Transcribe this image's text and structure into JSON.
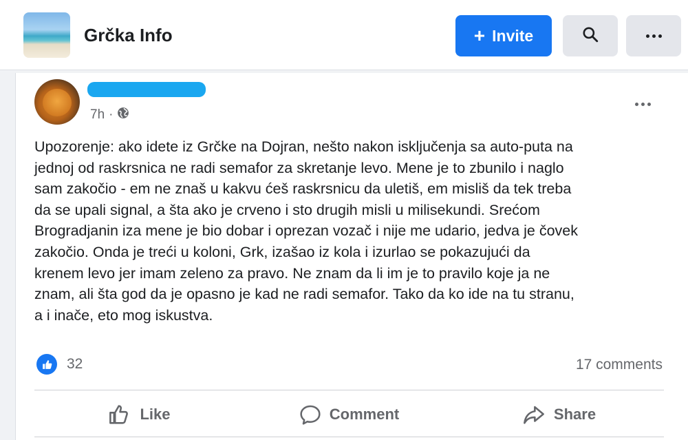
{
  "group": {
    "name": "Grčka Info",
    "invite_label": "Invite"
  },
  "icons": {
    "search": "search-icon",
    "more": "more-icon",
    "globe": "globe-icon",
    "like": "thumbs-up-icon",
    "comment": "comment-icon",
    "share": "share-icon"
  },
  "post": {
    "timestamp": "7h",
    "separator": "·",
    "body": "Upozorenje: ako idete iz Grčke na Dojran, nešto nakon isključenja sa auto-puta na\njednoj od raskrsnica ne radi semafor za skretanje levo. Mene je to zbunilo i naglo\nsam zakočio - em ne znaš u kakvu ćeš raskrsnicu da uletiš, em misliš da tek treba\nda se upali signal, a šta ako je crveno i sto drugih misli u milisekundi. Srećom\nBrogradjanin iza mene je bio dobar i oprezan vozač i nije me udario, jedva je čovek\nzakočio. Onda je treći u koloni, Grk, izašao iz kola i izurlao se pokazujući da\nkrenem levo jer imam zeleno za pravo. Ne znam da li im je to pravilo koje ja ne\nznam, ali šta god da je opasno je kad ne radi semafor. Tako da ko ide na tu stranu,\na i inače, eto mog iskustva.",
    "reactions_count": "32",
    "comments_label": "17 comments"
  },
  "actions": {
    "like": "Like",
    "comment": "Comment",
    "share": "Share"
  },
  "colors": {
    "accent": "#1877f2",
    "muted_text": "#65676b",
    "redaction": "#1aa7f0"
  }
}
